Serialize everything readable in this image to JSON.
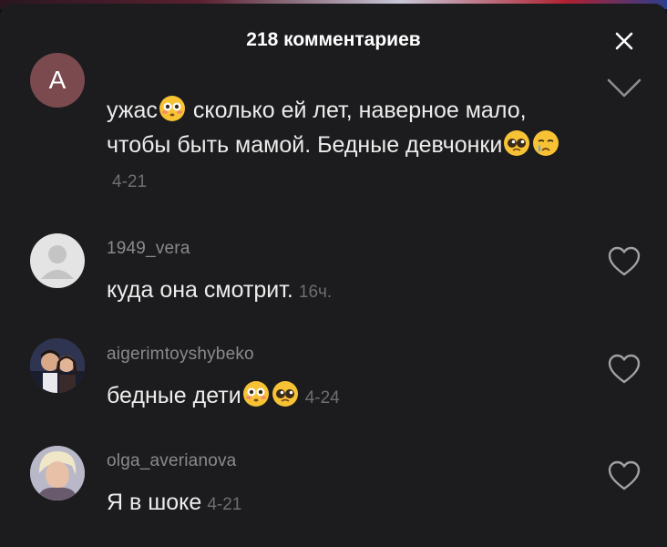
{
  "header": {
    "title": "218 комментариев"
  },
  "comments": [
    {
      "avatar_letter": "A",
      "text_parts": [
        "ужас",
        " сколько ей лет, наверное мало, чтобы быть мамой. Бедные девчонки"
      ],
      "emojis": [
        "flushed-face-emoji",
        "pleading-face-emoji",
        "crying-face-emoji"
      ],
      "time": "4-21",
      "action_icon": "chevron-down-icon"
    },
    {
      "username": "1949_vera",
      "text": "куда она смотрит.",
      "time": "16ч.",
      "avatar": "default-avatar-icon",
      "action_icon": "heart-outline-icon"
    },
    {
      "username": "aigerimtoyshybeko",
      "text": "бедные дети",
      "emojis": [
        "flushed-face-emoji",
        "pleading-face-emoji"
      ],
      "time": "4-24",
      "action_icon": "heart-outline-icon"
    },
    {
      "username": "olga_averianova",
      "text": "Я в шоке",
      "time": "4-21",
      "action_icon": "heart-outline-icon"
    }
  ],
  "colors": {
    "background": "#1c1c1e",
    "text": "#ececec",
    "username": "#8a8a8e",
    "time": "#6e6e73",
    "avatar_letter_bg": "#7a4a4e"
  }
}
